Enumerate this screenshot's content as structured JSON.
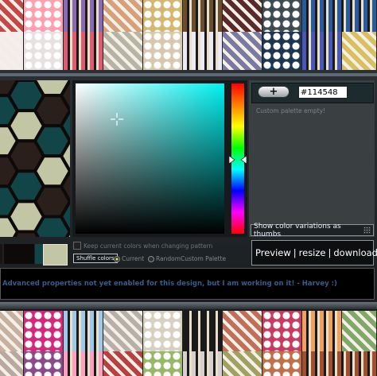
{
  "editor": {
    "hex_value": "#114548",
    "add_color_label": "+",
    "palette_empty": "Custom palette empty!",
    "variations_label": "Show color variations as thumbs",
    "keep_colors_label": "Keep current colors when changing pattern",
    "shuffle_label": "Shuffle colors",
    "radio_current": "Current",
    "radio_random": "RandomCustom Palette",
    "preview_label": "Preview",
    "resize_label": "resize",
    "download_label": "download",
    "separator": "|",
    "advanced_message": "Advanced properties not yet enabled for this design, but I am working on it! - Harvey :)",
    "pattern_colors": [
      "#114548",
      "#c3c6a4",
      "#2b1f1c",
      "#1d1412",
      "#0d0a09"
    ],
    "selected_hue": "#00ffff"
  },
  "thumbnails": {
    "row1": [
      "#c54848",
      "#ff9fb0",
      "#8a6ab4",
      "#d5a07a",
      "#d4b870",
      "#6b4e2e",
      "#5a2a2a",
      "#3e4b53",
      "#2a5aa0"
    ],
    "row2": [
      "#f4ecea",
      "#e8dfe0",
      "#e05a70",
      "#b8b4a4",
      "#d8c8b0",
      "#eceaf4",
      "#7a7aa0",
      "#1c3550",
      "#4858b8",
      "#d8c060"
    ],
    "row3": [
      "#c8b0a0",
      "#d4287a",
      "#a0c8e8",
      "#b8b0a8",
      "#d8d0c0",
      "#1a1a1a",
      "#c07058",
      "#c83a60",
      "#f0a060",
      "#80a868"
    ],
    "row4": [
      "#b8a8a0",
      "#8a4a8a",
      "#ff9fc0",
      "#b84040",
      "#98b868",
      "#d8d0d0",
      "#a0a060",
      "#c07048",
      "#a05030"
    ]
  }
}
